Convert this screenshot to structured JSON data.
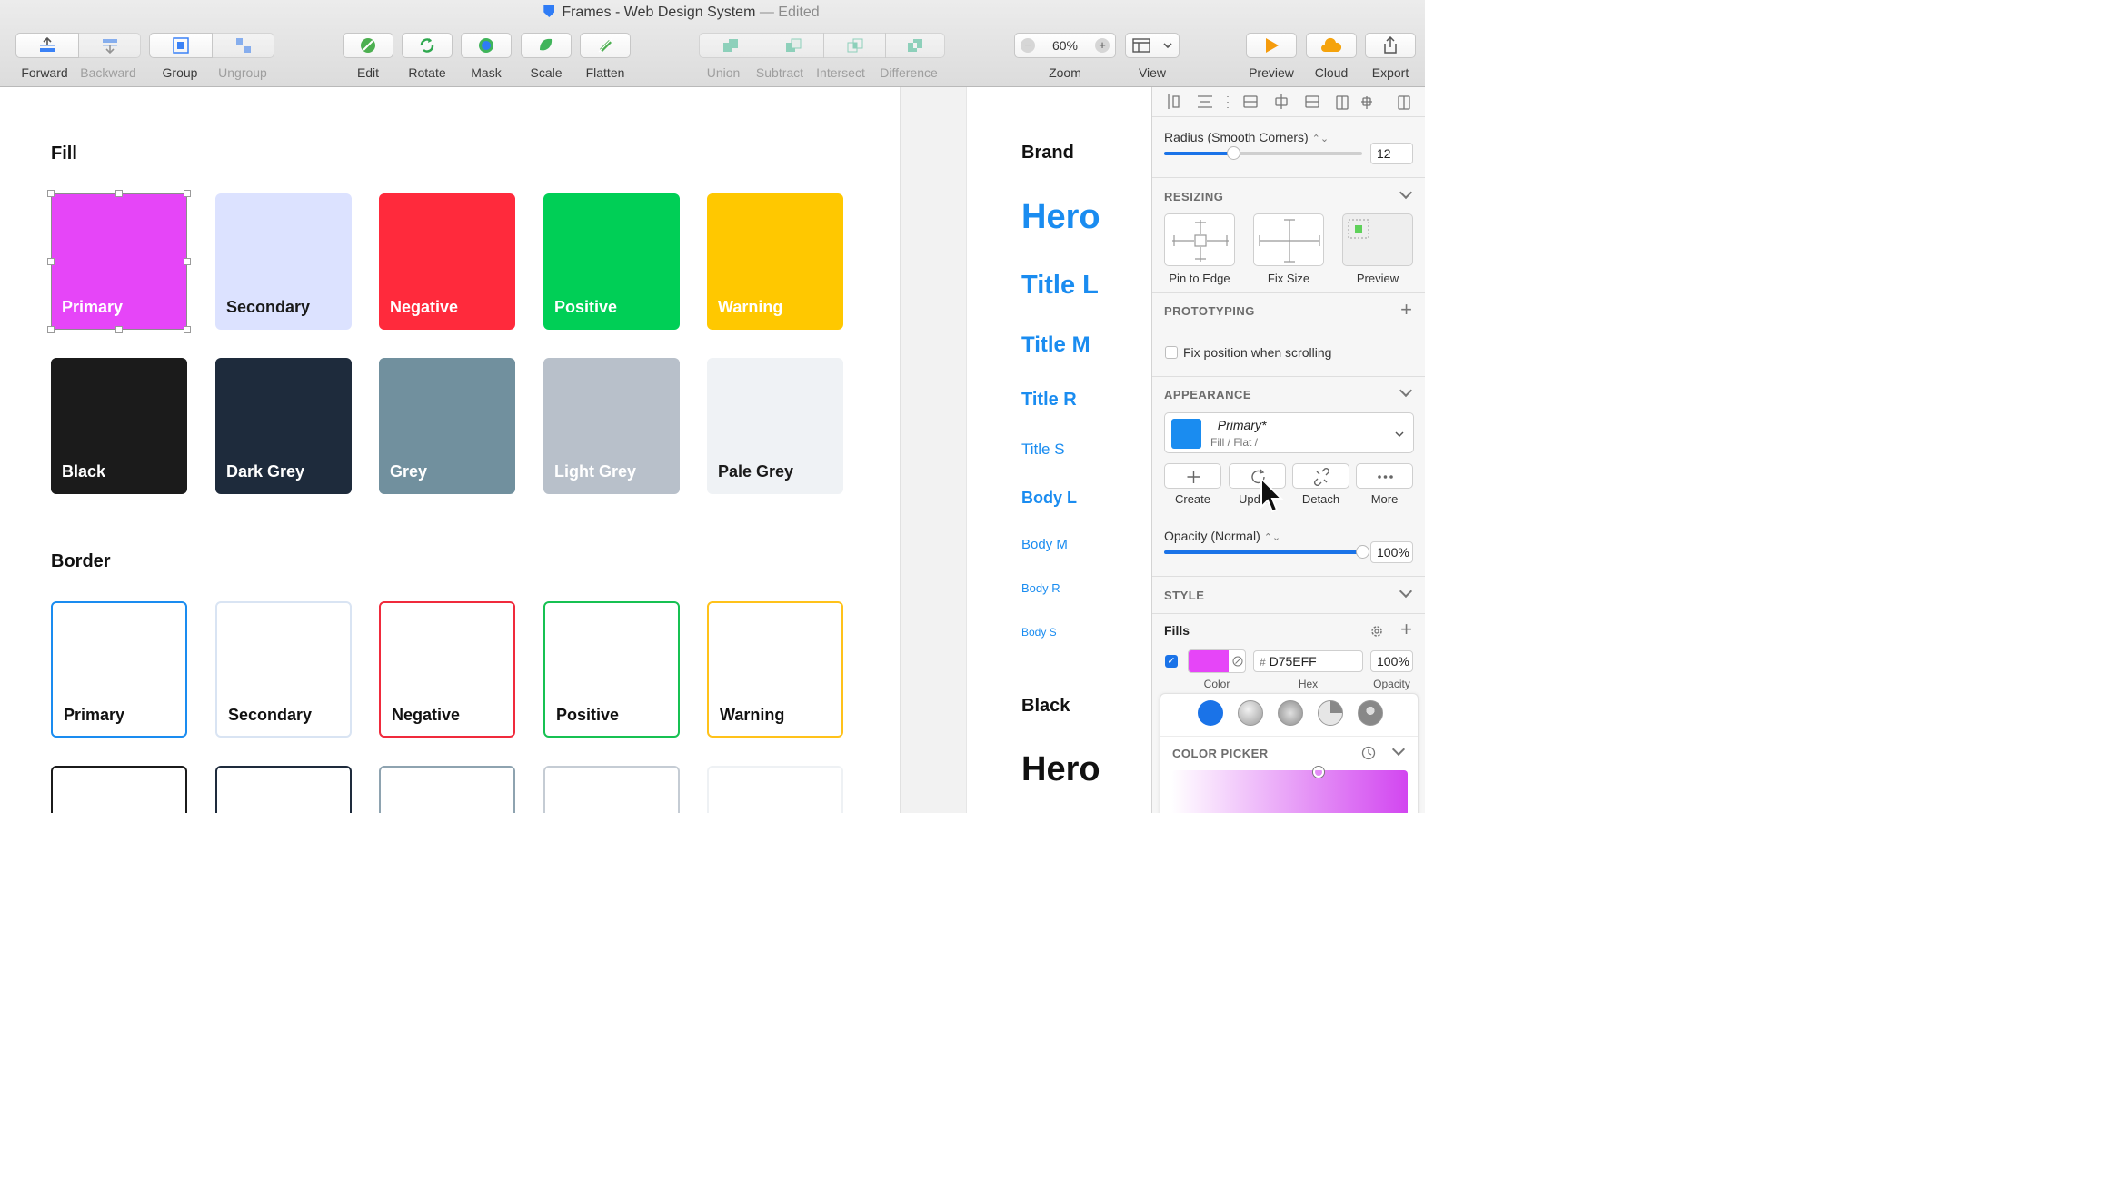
{
  "window": {
    "title": "Frames - Web Design System",
    "edited": "— Edited"
  },
  "toolbar": {
    "forward": "Forward",
    "backward": "Backward",
    "group": "Group",
    "ungroup": "Ungroup",
    "edit": "Edit",
    "rotate": "Rotate",
    "mask": "Mask",
    "scale": "Scale",
    "flatten": "Flatten",
    "union": "Union",
    "subtract": "Subtract",
    "intersect": "Intersect",
    "difference": "Difference",
    "zoom_label": "Zoom",
    "zoom_value": "60%",
    "zoom_minus": "−",
    "zoom_plus": "+",
    "view": "View",
    "preview": "Preview",
    "cloud": "Cloud",
    "export": "Export"
  },
  "canvas": {
    "fill_title": "Fill",
    "fill_swatches": [
      {
        "label": "Primary",
        "color": "#E645F8",
        "text": "#ffffff"
      },
      {
        "label": "Secondary",
        "color": "#DCE2FF",
        "text": "#1a1a1a"
      },
      {
        "label": "Negative",
        "color": "#FF2A3C",
        "text": "#ffffff"
      },
      {
        "label": "Positive",
        "color": "#00CF56",
        "text": "#ffffff"
      },
      {
        "label": "Warning",
        "color": "#FFC800",
        "text": "#ffffff"
      },
      {
        "label": "Black",
        "color": "#1B1B1B",
        "text": "#ffffff"
      },
      {
        "label": "Dark Grey",
        "color": "#1E2B3C",
        "text": "#ffffff"
      },
      {
        "label": "Grey",
        "color": "#71909E",
        "text": "#ffffff"
      },
      {
        "label": "Light Grey",
        "color": "#B8C0CA",
        "text": "#ffffff"
      },
      {
        "label": "Pale Grey",
        "color": "#EFF2F5",
        "text": "#1a1a1a"
      }
    ],
    "border_title": "Border",
    "border_swatches": [
      {
        "label": "Primary",
        "color": "#1A8CF0"
      },
      {
        "label": "Secondary",
        "color": "#D9E4F3"
      },
      {
        "label": "Negative",
        "color": "#F02A3C"
      },
      {
        "label": "Positive",
        "color": "#16C152"
      },
      {
        "label": "Warning",
        "color": "#FFC21A"
      },
      {
        "label": "",
        "color": "#1B1B1B"
      },
      {
        "label": "",
        "color": "#1E2B3C"
      },
      {
        "label": "",
        "color": "#8EA3B0"
      },
      {
        "label": "",
        "color": "#C5CCD4"
      },
      {
        "label": "",
        "color": "#EEF1F4"
      }
    ]
  },
  "typography": {
    "brand": "Brand",
    "hero": "Hero",
    "title_l": "Title L",
    "title_m": "Title M",
    "title_r": "Title R",
    "title_s": "Title S",
    "body_l": "Body L",
    "body_m": "Body M",
    "body_r": "Body R",
    "body_s": "Body S",
    "black": "Black",
    "hero_black": "Hero",
    "accent": "#1A8CF0"
  },
  "inspector": {
    "radius_label": "Radius (Smooth Corners)",
    "radius_value": "12",
    "radius_level": 0.35,
    "resizing": "RESIZING",
    "pin_to_edge": "Pin to Edge",
    "fix_size": "Fix Size",
    "preview": "Preview",
    "prototyping": "PROTOTYPING",
    "fix_position": "Fix position when scrolling",
    "appearance": "APPEARANCE",
    "style_name": "_Primary*",
    "style_path": "Fill / Flat /",
    "style_color": "#1A8CF0",
    "create": "Create",
    "update": "Upda",
    "detach": "Detach",
    "more": "More",
    "opacity_label": "Opacity (Normal)",
    "opacity_value": "100%",
    "opacity_level": 1.0,
    "style": "STYLE",
    "fills": "Fills",
    "fill_color": "#E645F8",
    "hex_prefix": "#",
    "hex": "D75EFF",
    "fill_opacity": "100%",
    "color_lbl": "Color",
    "hex_lbl": "Hex",
    "opacity_lbl": "Opacity",
    "color_picker": "COLOR PICKER"
  }
}
